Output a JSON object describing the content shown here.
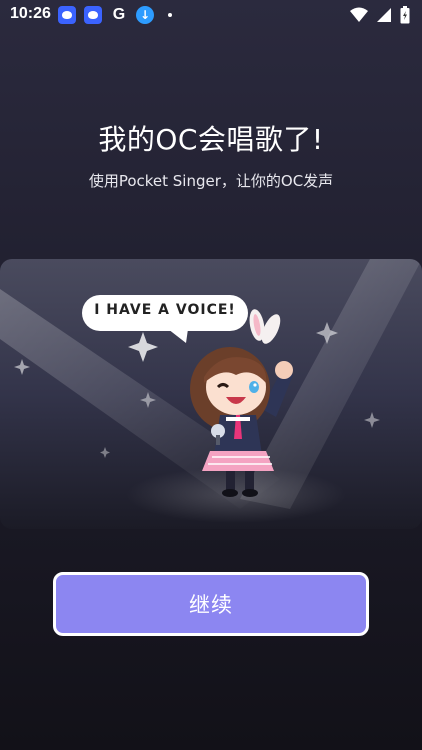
{
  "status_bar": {
    "time": "10:26",
    "icons": [
      "baidu-paw-icon",
      "baidu-paw-icon",
      "google-g-icon",
      "download-icon",
      "notification-dot-icon"
    ],
    "right_icons": [
      "wifi-icon",
      "signal-icon",
      "battery-icon"
    ],
    "google_glyph": "G"
  },
  "main": {
    "title": "我的OC会唱歌了!",
    "subtitle": "使用Pocket Singer，让你的OC发声",
    "speech_bubble": "I HAVE A VOICE!",
    "continue_label": "继续"
  },
  "colors": {
    "background": "#1f1e2d",
    "button_fill": "#8c86f1",
    "button_border": "#ffffff"
  }
}
